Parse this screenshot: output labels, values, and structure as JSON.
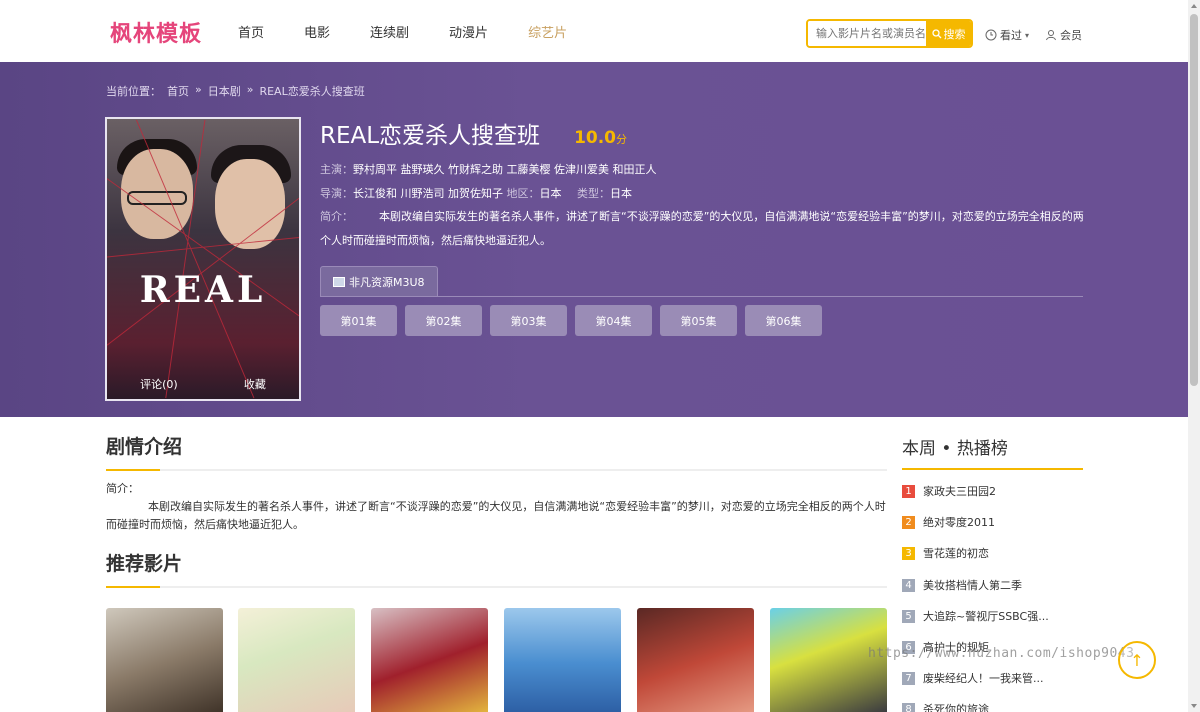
{
  "header": {
    "logo": "枫林模板",
    "nav": [
      {
        "label": "首页",
        "active": false
      },
      {
        "label": "电影",
        "active": false
      },
      {
        "label": "连续剧",
        "active": false
      },
      {
        "label": "动漫片",
        "active": false
      },
      {
        "label": "综艺片",
        "active": true
      }
    ],
    "search_placeholder": "输入影片片名或演员名称",
    "search_button": "搜索",
    "history_label": "看过",
    "member_label": "会员"
  },
  "breadcrumb": {
    "prefix": "当前位置：",
    "items": [
      "首页",
      "日本剧",
      "REAL恋爱杀人搜查班"
    ],
    "separator": "»"
  },
  "detail": {
    "title": "REAL恋爱杀人搜查班",
    "score": "10.0",
    "score_unit": "分",
    "actors_label": "主演：",
    "actors": "野村周平 盐野瑛久 竹财辉之助 工藤美樱 佐津川爱美 和田正人",
    "director_label": "导演：",
    "director": "长江俊和 川野浩司 加贺佐知子",
    "region_label": "地区：",
    "region": "日本",
    "type_label": "类型：",
    "type": "日本",
    "desc_label": "简介：",
    "desc": "本剧改编自实际发生的著名杀人事件，讲述了断言“不谈浮躁的恋爱”的大仪见，自信满满地说“恋爱经验丰富”的梦川，对恋爱的立场完全相反的两个人时而碰撞时而烦恼，然后痛快地逼近犯人。",
    "poster_title": "REAL",
    "poster_comment": "评论(0)",
    "poster_fav": "收藏"
  },
  "source": {
    "tab_label": "非凡资源M3U8",
    "episodes": [
      "第01集",
      "第02集",
      "第03集",
      "第04集",
      "第05集",
      "第06集"
    ]
  },
  "plot": {
    "title": "剧情介绍",
    "label": "简介：",
    "text": "本剧改编自实际发生的著名杀人事件，讲述了断言“不谈浮躁的恋爱”的大仪见，自信满满地说“恋爱经验丰富”的梦川，对恋爱的立场完全相反的两个人时而碰撞时而烦恼，然后痛快地逼近犯人。"
  },
  "recommend": {
    "title": "推荐影片"
  },
  "ranking": {
    "title": "本周 • 热播榜",
    "items": [
      {
        "rank": "1",
        "title": "家政夫三田园2",
        "color": "#e84c3d"
      },
      {
        "rank": "2",
        "title": "绝对零度2011",
        "color": "#f08c1e"
      },
      {
        "rank": "3",
        "title": "雪花莲的初恋",
        "color": "#f5b800"
      },
      {
        "rank": "4",
        "title": "美妆搭档情人第二季",
        "color": "#a0a8b8"
      },
      {
        "rank": "5",
        "title": "大追踪~警视厅SSBC强...",
        "color": "#a0a8b8"
      },
      {
        "rank": "6",
        "title": "高护士的规矩",
        "color": "#a0a8b8"
      },
      {
        "rank": "7",
        "title": "废柴经纪人！一我来管...",
        "color": "#a0a8b8"
      },
      {
        "rank": "8",
        "title": "杀死你的旅途",
        "color": "#a0a8b8"
      }
    ]
  },
  "watermark": "https://www.huzhan.com/ishop9043",
  "colors": {
    "accent": "#f5b800",
    "logo": "#e5457b",
    "hero_bg": "#6a5294"
  }
}
